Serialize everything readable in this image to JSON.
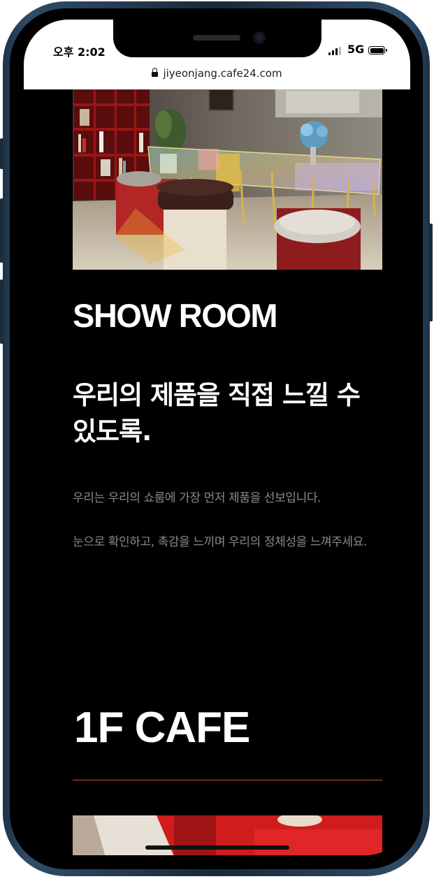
{
  "status_bar": {
    "time": "오후 2:02",
    "network": "5G"
  },
  "browser": {
    "url": "jiyeonjang.cafe24.com"
  },
  "showroom": {
    "heading": "SHOW ROOM",
    "subheading": "우리의 제품을 직접 느낄 수 있도록.",
    "paragraph_1": "우리는 우리의 쇼룸에 가장 먼저 제품을 선보입니다.",
    "paragraph_2": "눈으로 확인하고, 촉감을 느끼며 우리의 정체성을 느껴주세요."
  },
  "cafe": {
    "heading": "1F CAFE"
  },
  "colors": {
    "background": "#000000",
    "text": "#ffffff",
    "muted_text": "#8a8a8a",
    "divider": "#c0584c"
  },
  "icons": [
    "lock-icon",
    "signal-icon",
    "battery-icon"
  ]
}
